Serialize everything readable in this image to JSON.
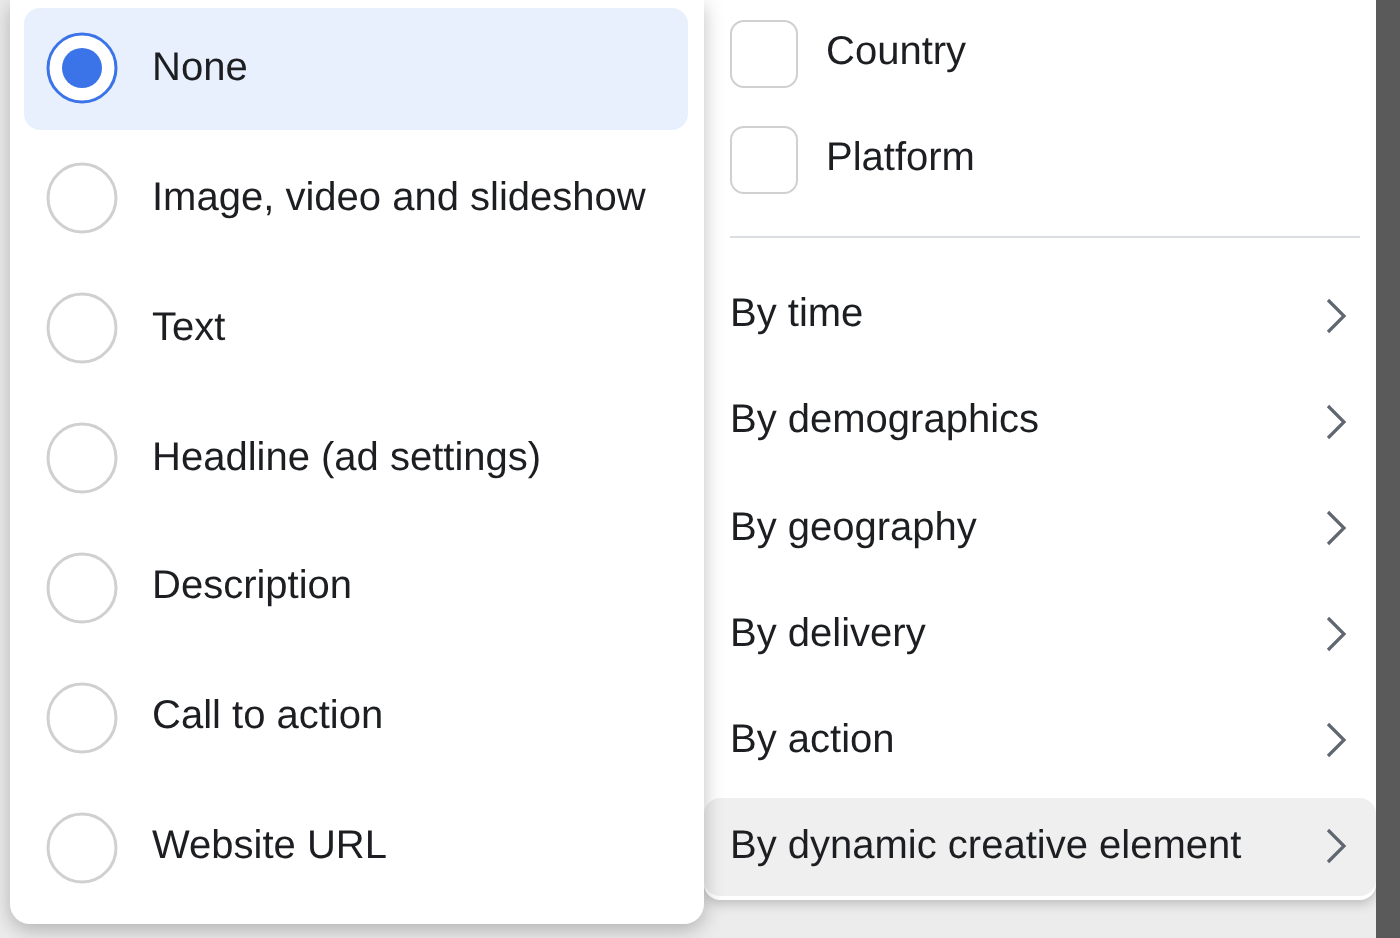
{
  "creative_options": [
    {
      "label": "None",
      "selected": true
    },
    {
      "label": "Image, video and slideshow",
      "selected": false
    },
    {
      "label": "Text",
      "selected": false
    },
    {
      "label": "Headline (ad settings)",
      "selected": false
    },
    {
      "label": "Description",
      "selected": false
    },
    {
      "label": "Call to action",
      "selected": false
    },
    {
      "label": "Website URL",
      "selected": false
    }
  ],
  "breakdown_checkboxes": [
    {
      "label": "Country",
      "checked": false
    },
    {
      "label": "Platform",
      "checked": false
    }
  ],
  "breakdown_menu": [
    {
      "label": "By time",
      "selected": false
    },
    {
      "label": "By demographics",
      "selected": false
    },
    {
      "label": "By geography",
      "selected": false
    },
    {
      "label": "By delivery",
      "selected": false
    },
    {
      "label": "By action",
      "selected": false
    },
    {
      "label": "By dynamic creative element",
      "selected": true
    }
  ]
}
